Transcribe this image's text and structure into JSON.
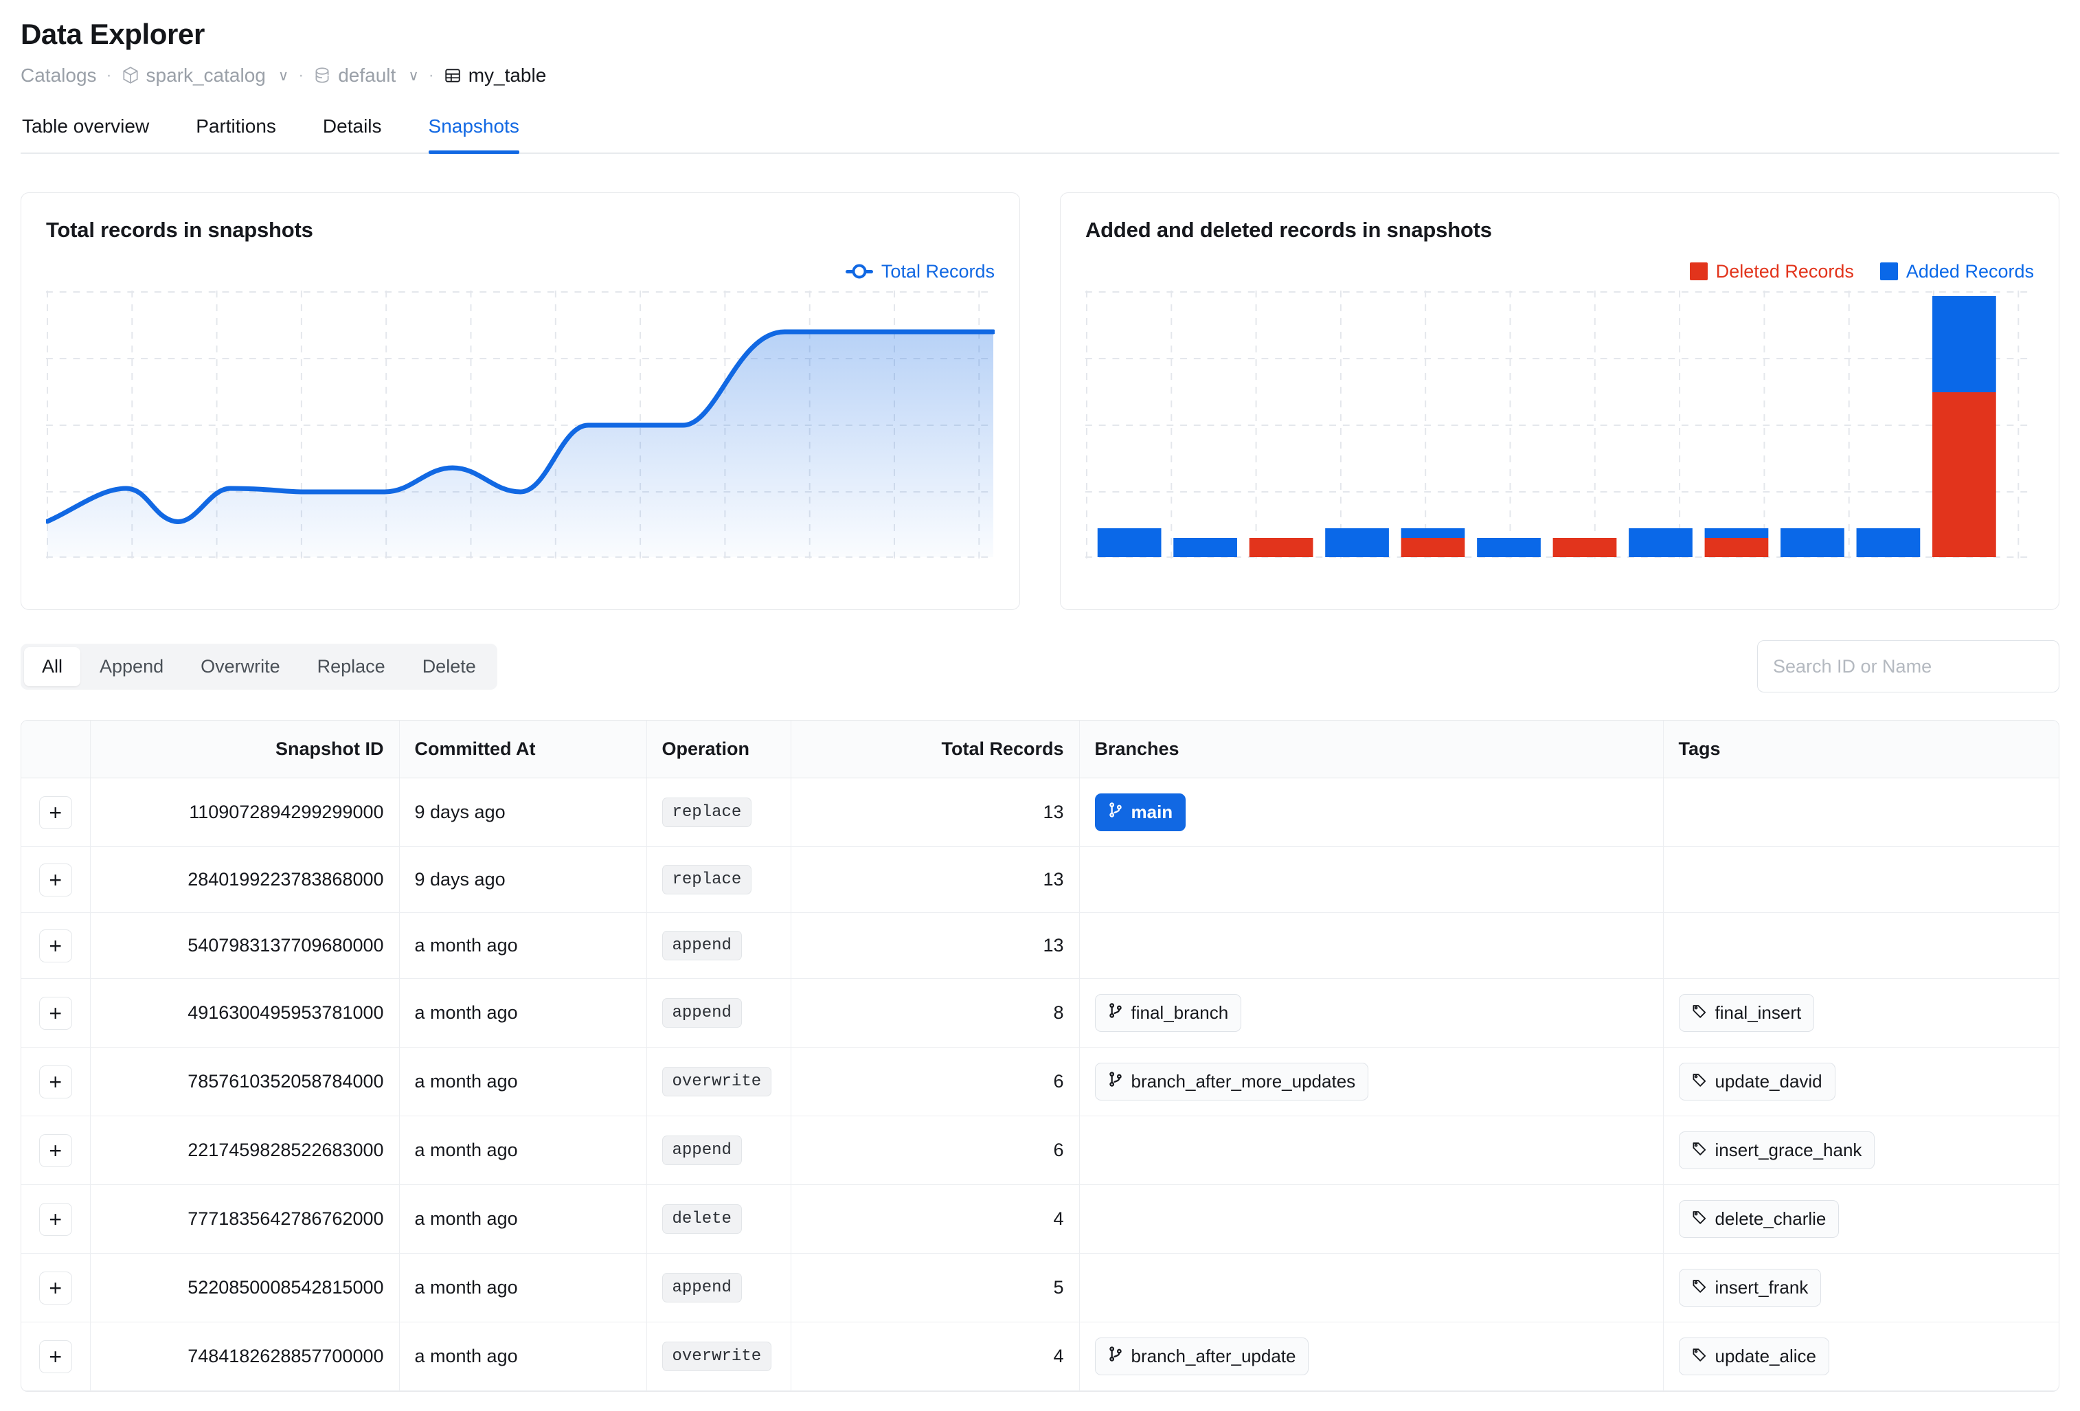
{
  "header": {
    "title": "Data Explorer",
    "breadcrumb": [
      {
        "label": "Catalogs",
        "icon": "",
        "chevron": false,
        "current": false
      },
      {
        "label": "spark_catalog",
        "icon": "cube-icon",
        "chevron": true,
        "current": false
      },
      {
        "label": "default",
        "icon": "database-icon",
        "chevron": true,
        "current": false
      },
      {
        "label": "my_table",
        "icon": "table-icon",
        "chevron": false,
        "current": true
      }
    ],
    "separator": "·"
  },
  "tabs": [
    {
      "label": "Table overview",
      "active": false
    },
    {
      "label": "Partitions",
      "active": false
    },
    {
      "label": "Details",
      "active": false
    },
    {
      "label": "Snapshots",
      "active": true
    }
  ],
  "colors": {
    "accent": "#1168e3",
    "added": "#0a68e8",
    "deleted": "#e2341c",
    "grid": "#e4e7ec",
    "text": "#16181d",
    "muted": "#9aa0a8"
  },
  "charts": {
    "left": {
      "title": "Total records in snapshots",
      "legend": [
        {
          "label": "Total Records",
          "color": "#1168e3",
          "marker": "line-dot"
        }
      ]
    },
    "right": {
      "title": "Added and deleted records in snapshots",
      "legend": [
        {
          "label": "Deleted Records",
          "color": "#e2341c",
          "marker": "square"
        },
        {
          "label": "Added Records",
          "color": "#0a68e8",
          "marker": "square"
        }
      ]
    }
  },
  "chart_data": [
    {
      "type": "area",
      "title": "Total records in snapshots",
      "series_name": "Total Records",
      "x": [
        1,
        2,
        3,
        4,
        5,
        6,
        7,
        8,
        9,
        10,
        11,
        12,
        13
      ],
      "values": [
        2,
        3,
        1,
        5,
        5,
        7,
        5,
        8,
        8,
        8,
        13,
        13,
        13
      ],
      "xlabel": "",
      "ylabel": "",
      "ylim": [
        0,
        15
      ],
      "grid": true,
      "legend_position": "top-right",
      "line_color": "#1168e3",
      "fill": "gradient-blue"
    },
    {
      "type": "bar",
      "title": "Added and deleted records in snapshots",
      "stacked": true,
      "categories": [
        "1",
        "2",
        "3",
        "4",
        "5",
        "6",
        "7",
        "8",
        "9",
        "10",
        "11",
        "12"
      ],
      "series": [
        {
          "name": "Added Records",
          "color": "#0a68e8",
          "values": [
            3,
            1,
            0,
            3,
            2,
            1,
            0,
            3,
            2,
            3,
            3,
            13
          ]
        },
        {
          "name": "Deleted Records",
          "color": "#e2341c",
          "values": [
            0,
            0,
            1,
            0,
            2,
            0,
            1,
            0,
            2,
            0,
            0,
            13
          ]
        }
      ],
      "ylim": [
        0,
        28
      ],
      "grid": true,
      "legend_position": "top-right"
    }
  ],
  "filters": {
    "options": [
      {
        "label": "All",
        "active": true
      },
      {
        "label": "Append",
        "active": false
      },
      {
        "label": "Overwrite",
        "active": false
      },
      {
        "label": "Replace",
        "active": false
      },
      {
        "label": "Delete",
        "active": false
      }
    ]
  },
  "search": {
    "value": "",
    "placeholder": "Search ID or Name"
  },
  "table": {
    "columns": [
      {
        "key": "expand",
        "label": "",
        "align": "left"
      },
      {
        "key": "snapshot_id",
        "label": "Snapshot ID",
        "align": "right"
      },
      {
        "key": "committed_at",
        "label": "Committed At",
        "align": "left"
      },
      {
        "key": "operation",
        "label": "Operation",
        "align": "left"
      },
      {
        "key": "total_records",
        "label": "Total Records",
        "align": "right"
      },
      {
        "key": "branches",
        "label": "Branches",
        "align": "left"
      },
      {
        "key": "tags",
        "label": "Tags",
        "align": "left"
      }
    ],
    "expand_label": "+",
    "rows": [
      {
        "snapshot_id": "1109072894299299000",
        "committed_at": "9 days ago",
        "operation": "replace",
        "total_records": "13",
        "branches": [
          {
            "label": "main",
            "primary": true
          }
        ],
        "tags": []
      },
      {
        "snapshot_id": "2840199223783868000",
        "committed_at": "9 days ago",
        "operation": "replace",
        "total_records": "13",
        "branches": [],
        "tags": []
      },
      {
        "snapshot_id": "5407983137709680000",
        "committed_at": "a month ago",
        "operation": "append",
        "total_records": "13",
        "branches": [],
        "tags": []
      },
      {
        "snapshot_id": "4916300495953781000",
        "committed_at": "a month ago",
        "operation": "append",
        "total_records": "8",
        "branches": [
          {
            "label": "final_branch",
            "primary": false
          }
        ],
        "tags": [
          {
            "label": "final_insert"
          }
        ]
      },
      {
        "snapshot_id": "7857610352058784000",
        "committed_at": "a month ago",
        "operation": "overwrite",
        "total_records": "6",
        "branches": [
          {
            "label": "branch_after_more_updates",
            "primary": false
          }
        ],
        "tags": [
          {
            "label": "update_david"
          }
        ]
      },
      {
        "snapshot_id": "2217459828522683000",
        "committed_at": "a month ago",
        "operation": "append",
        "total_records": "6",
        "branches": [],
        "tags": [
          {
            "label": "insert_grace_hank"
          }
        ]
      },
      {
        "snapshot_id": "7771835642786762000",
        "committed_at": "a month ago",
        "operation": "delete",
        "total_records": "4",
        "branches": [],
        "tags": [
          {
            "label": "delete_charlie"
          }
        ]
      },
      {
        "snapshot_id": "5220850008542815000",
        "committed_at": "a month ago",
        "operation": "append",
        "total_records": "5",
        "branches": [],
        "tags": [
          {
            "label": "insert_frank"
          }
        ]
      },
      {
        "snapshot_id": "7484182628857700000",
        "committed_at": "a month ago",
        "operation": "overwrite",
        "total_records": "4",
        "branches": [
          {
            "label": "branch_after_update",
            "primary": false
          }
        ],
        "tags": [
          {
            "label": "update_alice"
          }
        ]
      }
    ]
  }
}
